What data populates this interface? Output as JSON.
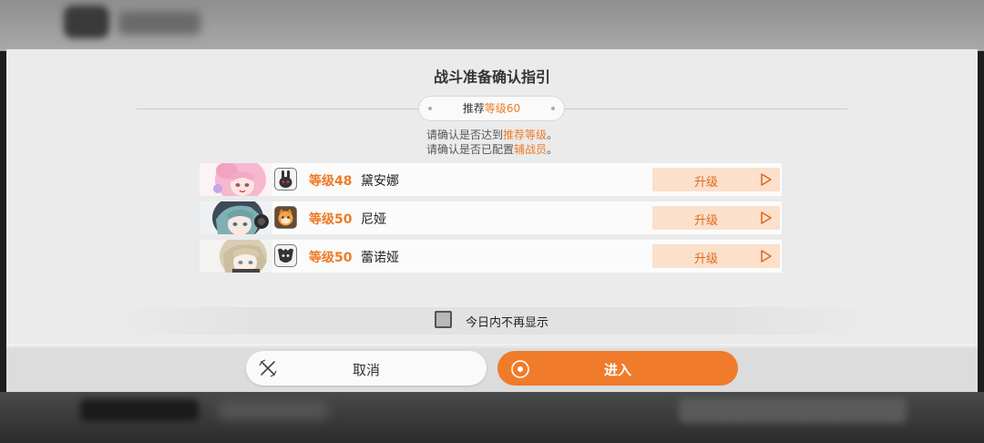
{
  "dialog": {
    "title": "战斗准备确认指引",
    "recommend_prefix": "推荐",
    "recommend_value": "等级60",
    "note1": {
      "pre": "请确认是否达到",
      "em": "推荐等级",
      "post": "。"
    },
    "note2": {
      "pre": "请确认是否已配置",
      "em": "辅战员",
      "post": "。"
    }
  },
  "characters": [
    {
      "level": "等级48",
      "name": "黛安娜",
      "button": "升级",
      "portrait": "pink-hair-girl",
      "badge_icon": "rabbit-icon"
    },
    {
      "level": "等级50",
      "name": "尼娅",
      "button": "升级",
      "portrait": "teal-hair-girl-headphones",
      "badge_icon": "orange-cat-icon"
    },
    {
      "level": "等级50",
      "name": "蕾诺娅",
      "button": "升级",
      "portrait": "blonde-hair-girl",
      "badge_icon": "dark-creature-icon"
    }
  ],
  "checkbox": {
    "label": "今日内不再显示",
    "checked": false
  },
  "buttons": {
    "cancel": "取消",
    "enter": "进入"
  },
  "colors": {
    "accent": "#ee7b26",
    "upgrade_bg": "#fbe0cc",
    "panel": "#ebebeb"
  }
}
